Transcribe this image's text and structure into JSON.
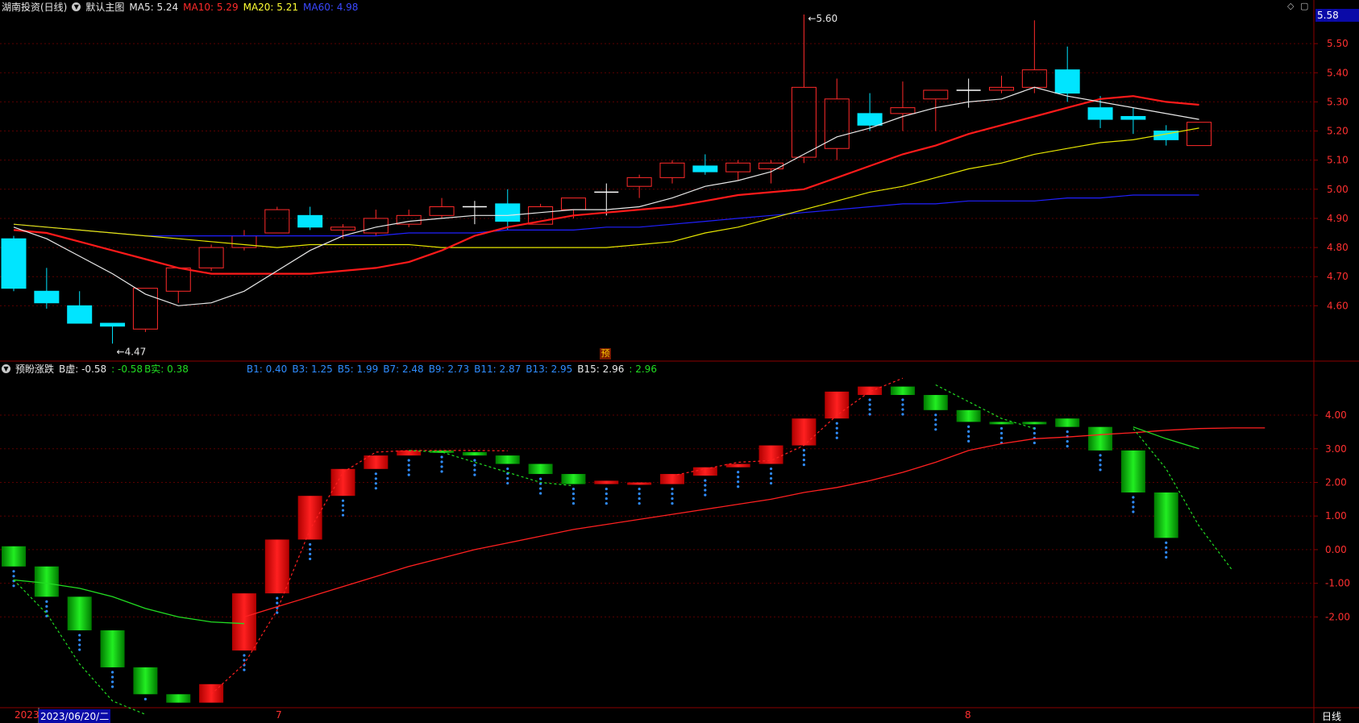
{
  "header_main": {
    "stock": "湖南投资(日线)",
    "template": "默认主图",
    "ma5": "MA5: 5.24",
    "ma10": "MA10: 5.29",
    "ma20": "MA20: 5.21",
    "ma60": "MA60: 4.98"
  },
  "header_sub": {
    "indicator": "预盼涨跌",
    "b_xu": "B虚: -0.58",
    "val2": ": -0.58",
    "b_shi": "B实: 0.38",
    "b1": "B1: 0.40",
    "b3": "B3: 1.25",
    "b5": "B5: 1.99",
    "b7": "B7: 2.48",
    "b9": "B9: 2.73",
    "b11": "B11: 2.87",
    "b13": "B13: 2.95",
    "b15": "B15: 2.96",
    "val_last": ": 2.96"
  },
  "price_badge": "5.58",
  "marker_yu": "预",
  "period": "日线",
  "date_bar": {
    "year": "2023",
    "date": "2023/06/20/二",
    "m7": "7",
    "m8": "8"
  },
  "colors": {
    "up": "#ff2a2a",
    "down": "#00e5ff",
    "ma5": "#e8e8e8",
    "ma10": "#ff1a1a",
    "ma20": "#e6e600",
    "ma60": "#2020ff",
    "grid": "#5a0000",
    "axis": "#8b0000"
  },
  "chart_data": [
    {
      "type": "candlestick",
      "title": "湖南投资(日线)",
      "y_ticks": [
        5.5,
        5.4,
        5.3,
        5.2,
        5.1,
        5.0,
        4.9,
        4.8,
        4.7,
        4.6
      ],
      "ylim": [
        4.41,
        5.6
      ],
      "annotations": [
        {
          "label": "5.60",
          "index": 24,
          "value": 5.6
        },
        {
          "label": "4.47",
          "index": 3,
          "value": 4.47
        }
      ],
      "ohlc": [
        [
          4.83,
          4.84,
          4.65,
          4.66
        ],
        [
          4.65,
          4.73,
          4.59,
          4.61
        ],
        [
          4.6,
          4.65,
          4.56,
          4.54
        ],
        [
          4.54,
          4.54,
          4.47,
          4.53
        ],
        [
          4.52,
          4.66,
          4.51,
          4.66
        ],
        [
          4.65,
          4.73,
          4.61,
          4.73
        ],
        [
          4.73,
          4.81,
          4.72,
          4.8
        ],
        [
          4.8,
          4.86,
          4.79,
          4.84
        ],
        [
          4.85,
          4.94,
          4.85,
          4.93
        ],
        [
          4.91,
          4.94,
          4.86,
          4.87
        ],
        [
          4.86,
          4.88,
          4.83,
          4.87
        ],
        [
          4.85,
          4.93,
          4.84,
          4.9
        ],
        [
          4.88,
          4.93,
          4.87,
          4.91
        ],
        [
          4.91,
          4.97,
          4.9,
          4.94
        ],
        [
          4.94,
          4.96,
          4.88,
          4.94
        ],
        [
          4.95,
          5.0,
          4.86,
          4.89
        ],
        [
          4.88,
          4.95,
          4.88,
          4.94
        ],
        [
          4.93,
          4.97,
          4.9,
          4.97
        ],
        [
          4.99,
          5.02,
          4.91,
          4.99
        ],
        [
          5.01,
          5.05,
          4.97,
          5.04
        ],
        [
          5.04,
          5.1,
          5.02,
          5.09
        ],
        [
          5.08,
          5.12,
          5.05,
          5.06
        ],
        [
          5.06,
          5.1,
          5.03,
          5.09
        ],
        [
          5.07,
          5.1,
          5.02,
          5.09
        ],
        [
          5.11,
          5.6,
          5.09,
          5.35
        ],
        [
          5.14,
          5.38,
          5.1,
          5.31
        ],
        [
          5.26,
          5.33,
          5.2,
          5.22
        ],
        [
          5.26,
          5.37,
          5.2,
          5.28
        ],
        [
          5.31,
          5.34,
          5.2,
          5.34
        ],
        [
          5.34,
          5.38,
          5.28,
          5.34
        ],
        [
          5.34,
          5.39,
          5.33,
          5.35
        ],
        [
          5.35,
          5.58,
          5.33,
          5.41
        ],
        [
          5.41,
          5.49,
          5.3,
          5.33
        ],
        [
          5.28,
          5.32,
          5.21,
          5.24
        ],
        [
          5.25,
          5.28,
          5.19,
          5.24
        ],
        [
          5.2,
          5.22,
          5.15,
          5.17
        ],
        [
          5.15,
          5.23,
          5.15,
          5.23
        ]
      ],
      "ma5": [
        4.87,
        4.83,
        4.77,
        4.71,
        4.64,
        4.6,
        4.61,
        4.65,
        4.72,
        4.79,
        4.84,
        4.87,
        4.89,
        4.9,
        4.91,
        4.91,
        4.92,
        4.93,
        4.93,
        4.94,
        4.97,
        5.01,
        5.03,
        5.06,
        5.12,
        5.18,
        5.21,
        5.25,
        5.28,
        5.3,
        5.31,
        5.35,
        5.32,
        5.3,
        5.28,
        5.26,
        5.24
      ],
      "ma10": [
        4.86,
        4.85,
        4.82,
        4.79,
        4.76,
        4.73,
        4.71,
        4.71,
        4.71,
        4.71,
        4.72,
        4.73,
        4.75,
        4.79,
        4.84,
        4.87,
        4.89,
        4.91,
        4.92,
        4.93,
        4.94,
        4.96,
        4.98,
        4.99,
        5.0,
        5.04,
        5.08,
        5.12,
        5.15,
        5.19,
        5.22,
        5.25,
        5.28,
        5.31,
        5.32,
        5.3,
        5.29
      ],
      "ma20": [
        4.88,
        4.87,
        4.86,
        4.85,
        4.84,
        4.83,
        4.82,
        4.81,
        4.8,
        4.81,
        4.81,
        4.81,
        4.81,
        4.8,
        4.8,
        4.8,
        4.8,
        4.8,
        4.8,
        4.81,
        4.82,
        4.85,
        4.87,
        4.9,
        4.93,
        4.96,
        4.99,
        5.01,
        5.04,
        5.07,
        5.09,
        5.12,
        5.14,
        5.16,
        5.17,
        5.19,
        5.21
      ],
      "ma60": [
        4.88,
        4.87,
        4.86,
        4.85,
        4.84,
        4.84,
        4.84,
        4.84,
        4.84,
        4.84,
        4.84,
        4.84,
        4.85,
        4.85,
        4.85,
        4.86,
        4.86,
        4.86,
        4.87,
        4.87,
        4.88,
        4.89,
        4.9,
        4.91,
        4.92,
        4.93,
        4.94,
        4.95,
        4.95,
        4.96,
        4.96,
        4.96,
        4.97,
        4.97,
        4.98,
        4.98,
        4.98
      ]
    },
    {
      "type": "bar",
      "title": "预盼涨跌",
      "y_ticks": [
        4.0,
        3.0,
        2.0,
        1.0,
        0.0,
        -1.0,
        -2.0
      ],
      "ylim": [
        -4.7,
        5.2
      ],
      "bars": [
        [
          0.1,
          -0.5
        ],
        [
          -0.5,
          -1.4
        ],
        [
          -1.4,
          -2.4
        ],
        [
          -2.4,
          -3.5
        ],
        [
          -3.5,
          -4.3
        ],
        [
          -4.3,
          -4.55
        ],
        [
          -4.55,
          -4.0
        ],
        [
          -3.0,
          -1.3
        ],
        [
          -1.3,
          0.3
        ],
        [
          0.3,
          1.6
        ],
        [
          1.6,
          2.4
        ],
        [
          2.4,
          2.8
        ],
        [
          2.8,
          2.95
        ],
        [
          2.95,
          2.9
        ],
        [
          2.9,
          2.8
        ],
        [
          2.8,
          2.55
        ],
        [
          2.55,
          2.25
        ],
        [
          2.25,
          1.95
        ],
        [
          1.95,
          2.05
        ],
        [
          1.95,
          2.0
        ],
        [
          1.95,
          2.25
        ],
        [
          2.2,
          2.45
        ],
        [
          2.45,
          2.55
        ],
        [
          2.55,
          3.1
        ],
        [
          3.1,
          3.9
        ],
        [
          3.9,
          4.7
        ],
        [
          4.6,
          4.85
        ],
        [
          4.85,
          4.6
        ],
        [
          4.6,
          4.15
        ],
        [
          4.15,
          3.8
        ],
        [
          3.8,
          3.75
        ],
        [
          3.8,
          3.75
        ],
        [
          3.9,
          3.65
        ],
        [
          3.65,
          2.95
        ],
        [
          2.95,
          1.7
        ],
        [
          1.7,
          0.35
        ]
      ],
      "line_red": [
        null,
        null,
        null,
        null,
        null,
        null,
        null,
        -2.0,
        -1.7,
        -1.4,
        -1.1,
        -0.8,
        -0.5,
        -0.25,
        0.0,
        0.2,
        0.4,
        0.6,
        0.75,
        0.9,
        1.05,
        1.2,
        1.35,
        1.5,
        1.7,
        1.85,
        2.05,
        2.3,
        2.6,
        2.95,
        3.15,
        3.3,
        3.35,
        3.42,
        3.48,
        3.55,
        3.6,
        3.62,
        3.62
      ],
      "dashed_red": [
        null,
        null,
        null,
        null,
        null,
        null,
        -4.3,
        -3.4,
        -1.8,
        0.6,
        2.3,
        2.9,
        2.95,
        2.95,
        2.95,
        2.94,
        null,
        null,
        null,
        null,
        2.2,
        2.4,
        2.6,
        2.65,
        3.1,
        4.0,
        4.7,
        5.1
      ],
      "line_green": [
        -0.9,
        -1.0,
        -1.15,
        -1.4,
        -1.75,
        -2.0,
        -2.15,
        -2.2,
        null,
        null,
        null,
        null,
        null,
        null,
        null,
        null,
        null,
        null,
        null,
        null,
        null,
        null,
        null,
        null,
        null,
        null,
        null,
        null,
        null,
        null,
        null,
        null,
        null,
        null,
        3.65,
        3.3,
        3.0
      ],
      "dashed_green": [
        -0.9,
        -1.9,
        -3.4,
        -4.5,
        -4.9,
        null,
        null,
        null,
        null,
        null,
        null,
        null,
        2.95,
        2.9,
        2.6,
        2.3,
        2.0,
        1.9,
        null,
        null,
        null,
        null,
        null,
        null,
        null,
        null,
        null,
        null,
        4.9,
        4.4,
        3.9,
        3.6,
        null,
        null,
        3.6,
        2.4,
        0.7,
        -0.6
      ]
    }
  ]
}
